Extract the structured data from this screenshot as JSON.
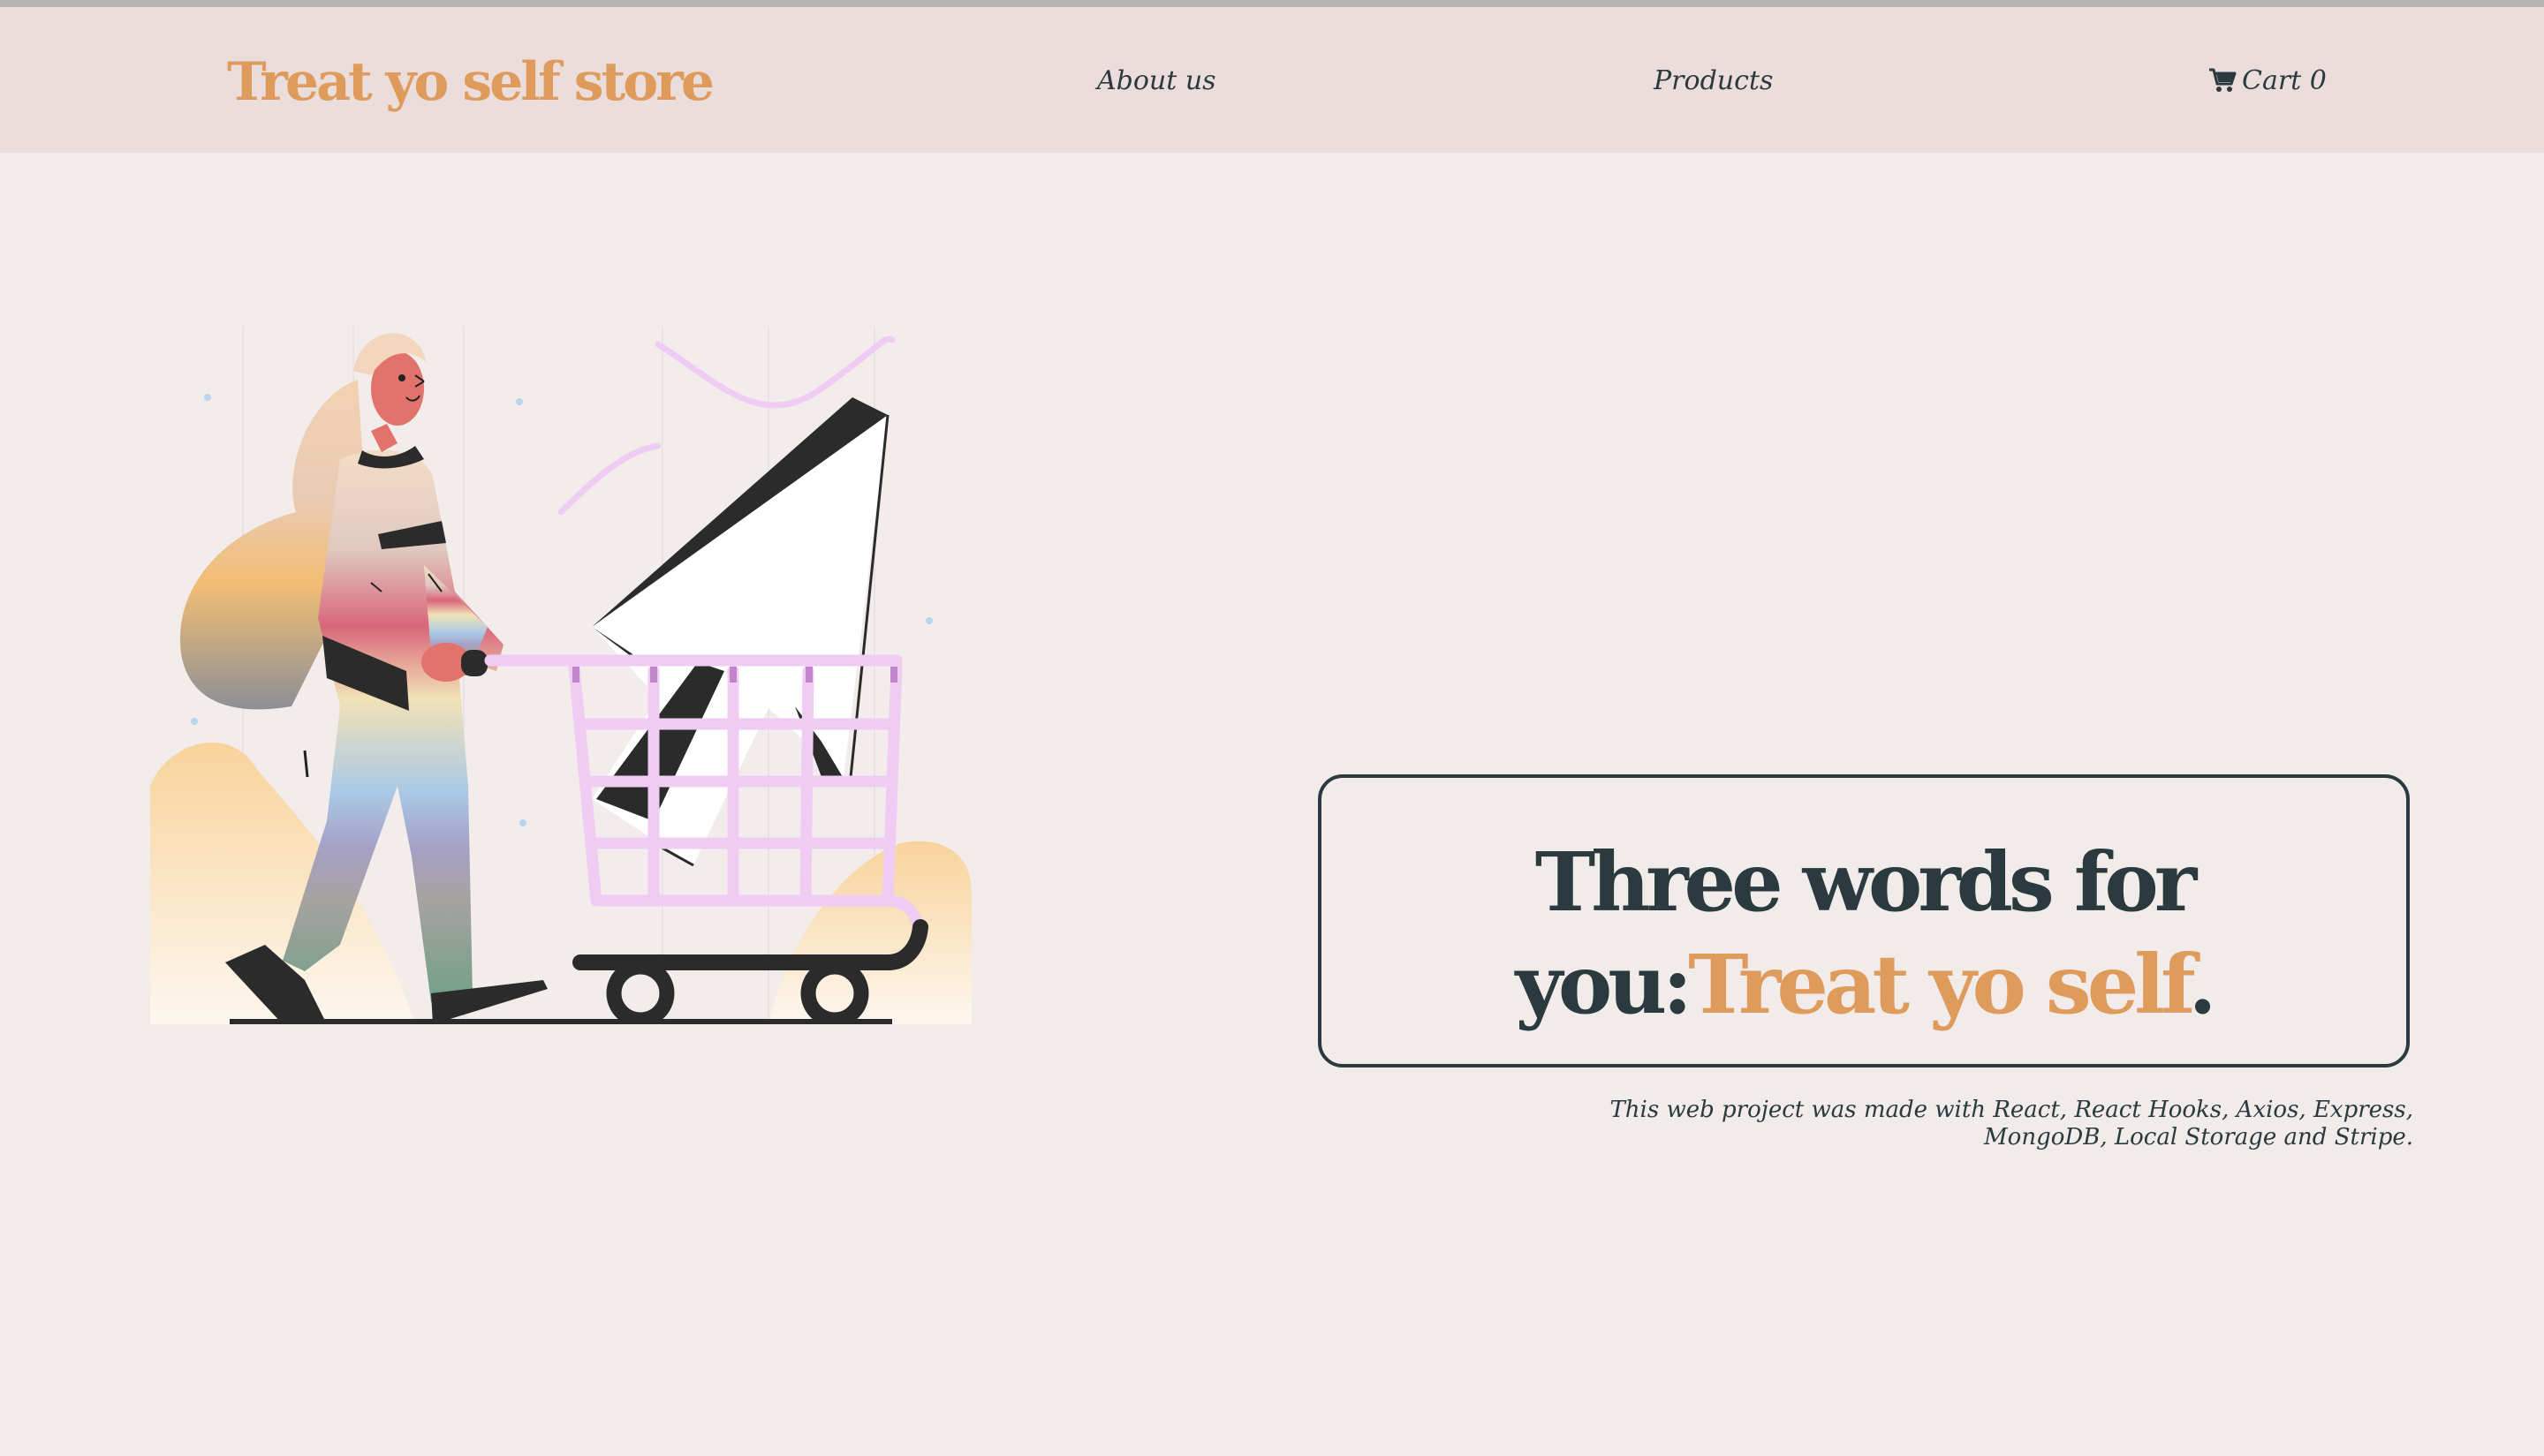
{
  "navbar": {
    "brand": "Treat yo self store",
    "about_label": "About us",
    "products_label": "Products",
    "cart_label": "Cart",
    "cart_count": "0",
    "cart_icon": "shopping-cart-icon"
  },
  "hero": {
    "heading_part1": "Three words for",
    "heading_part2": "you:",
    "heading_accent": "Treat yo self",
    "heading_end": "."
  },
  "footer": {
    "credits_line1": "This web project was made with React, React Hooks, Axios, Express,",
    "credits_line2": "MongoDB, Local Storage and Stripe."
  },
  "colors": {
    "brand": "#df9b5c",
    "text": "#2a3a3e",
    "navbar_bg": "#ebdddb",
    "page_bg": "#f1ebe9"
  }
}
